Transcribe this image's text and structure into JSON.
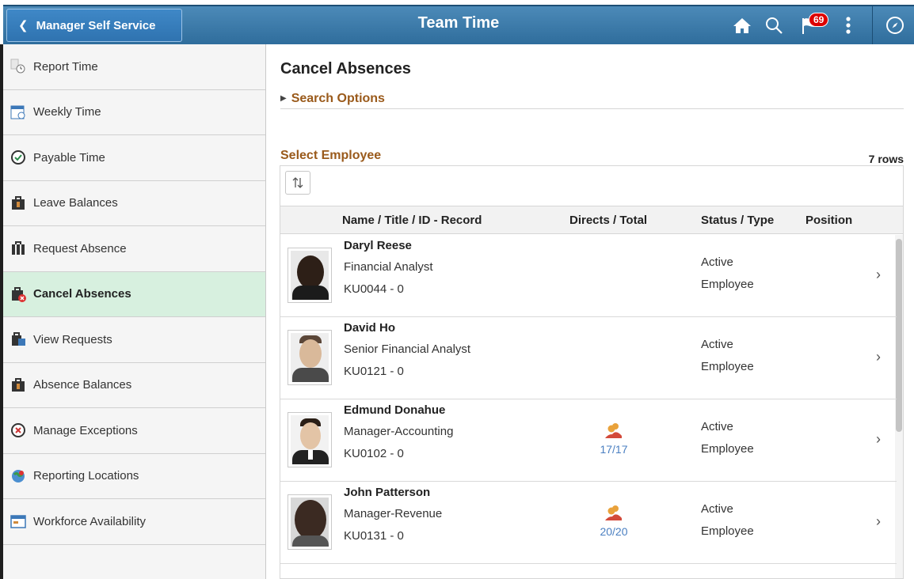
{
  "header": {
    "back_label": "Manager Self Service",
    "title": "Team Time",
    "notification_count": "69",
    "icons": [
      "home-icon",
      "search-icon",
      "notification-flag-icon",
      "more-actions-icon",
      "navbar-compass-icon"
    ]
  },
  "sidebar": {
    "items": [
      {
        "label": "Report Time",
        "icon": "report-time-icon"
      },
      {
        "label": "Weekly Time",
        "icon": "weekly-time-icon"
      },
      {
        "label": "Payable Time",
        "icon": "payable-time-icon"
      },
      {
        "label": "Leave Balances",
        "icon": "leave-balances-icon"
      },
      {
        "label": "Request Absence",
        "icon": "request-absence-icon"
      },
      {
        "label": "Cancel Absences",
        "icon": "cancel-absences-icon",
        "active": true
      },
      {
        "label": "View Requests",
        "icon": "view-requests-icon"
      },
      {
        "label": "Absence Balances",
        "icon": "absence-balances-icon"
      },
      {
        "label": "Manage Exceptions",
        "icon": "manage-exceptions-icon"
      },
      {
        "label": "Reporting Locations",
        "icon": "reporting-locations-icon"
      },
      {
        "label": "Workforce Availability",
        "icon": "workforce-availability-icon"
      }
    ]
  },
  "main": {
    "title": "Cancel Absences",
    "search_options": "Search Options",
    "section_title": "Select Employee",
    "row_count": "7 rows",
    "columns": {
      "name": "Name / Title / ID - Record",
      "directs": "Directs / Total",
      "status": "Status / Type",
      "position": "Position"
    },
    "employees": [
      {
        "name": "Daryl Reese",
        "title": "Financial Analyst",
        "id": "KU0044 - 0",
        "directs": "",
        "status": "Active",
        "type": "Employee"
      },
      {
        "name": "David Ho",
        "title": "Senior Financial Analyst",
        "id": "KU0121 - 0",
        "directs": "",
        "status": "Active",
        "type": "Employee"
      },
      {
        "name": "Edmund Donahue",
        "title": "Manager-Accounting",
        "id": "KU0102 - 0",
        "directs": "17/17",
        "status": "Active",
        "type": "Employee"
      },
      {
        "name": "John Patterson",
        "title": "Manager-Revenue",
        "id": "KU0131 - 0",
        "directs": "20/20",
        "status": "Active",
        "type": "Employee"
      }
    ]
  },
  "colors": {
    "banner": "#2f6d9c",
    "accent_brown": "#9a5a1b",
    "active_item": "#d7f0df",
    "link_blue": "#4a7fc1",
    "badge_red": "#dd0000"
  }
}
